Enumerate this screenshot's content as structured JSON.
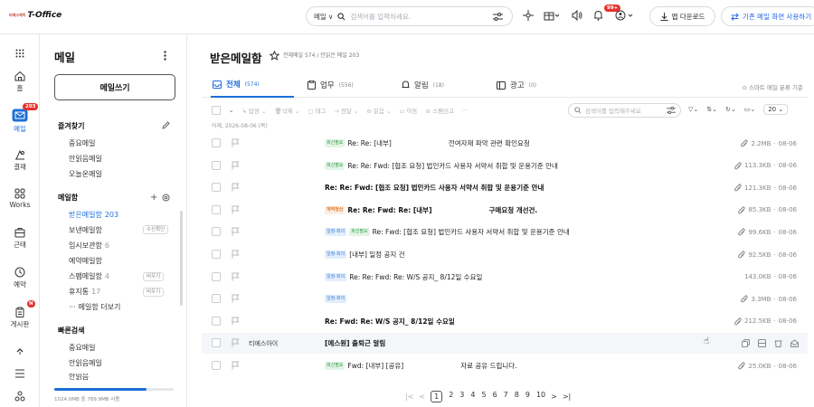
{
  "header": {
    "logo_small": "티에스에이",
    "logo_big": "T-Office",
    "search_scope": "메일",
    "search_placeholder": "검색어를 입력하세요.",
    "notification_badge": "99+",
    "app_download": "앱 다운로드",
    "old_mail_screen": "기존 메일 화면 사용하기"
  },
  "rail": [
    {
      "label": "홈",
      "icon": "home-icon"
    },
    {
      "label": "메일",
      "icon": "mail-icon",
      "badge": "203",
      "active": true
    },
    {
      "label": "결재",
      "icon": "approval-icon"
    },
    {
      "label": "Works",
      "icon": "works-icon"
    },
    {
      "label": "근태",
      "icon": "attendance-icon"
    },
    {
      "label": "예약",
      "icon": "reservation-icon"
    },
    {
      "label": "게시판",
      "icon": "board-icon",
      "badge": "N"
    }
  ],
  "mailnav": {
    "title": "메일",
    "compose": "메일쓰기",
    "favorites_title": "즐겨찾기",
    "favorites": [
      "중요메일",
      "안읽음메일",
      "오늘온메일"
    ],
    "mailbox_title": "메일함",
    "mailboxes": [
      {
        "label": "받은메일함",
        "count": "203",
        "active": true
      },
      {
        "label": "보낸메일함",
        "chip": "수신확인"
      },
      {
        "label": "임시보관함",
        "count": "6"
      },
      {
        "label": "예약메일함"
      },
      {
        "label": "스팸메일함",
        "count": "4",
        "chip": "비우기"
      },
      {
        "label": "휴지통",
        "count": "17",
        "chip": "비우기"
      },
      {
        "label": "메일함 더보기",
        "prefix": "···"
      }
    ],
    "quick_title": "빠른검색",
    "quick": [
      "중요메일",
      "안읽음메일",
      "안읽음"
    ],
    "quota": "1024.0MB 중 789.9MB 사용",
    "quota_fraction": 0.77
  },
  "main": {
    "title": "받은메일함",
    "subtitle": "전체메일 574 / 안읽은 메일 203",
    "tabs": [
      {
        "label": "전체",
        "count": "(574)",
        "icon": "inbox-icon",
        "active": true
      },
      {
        "label": "업무",
        "count": "(556)",
        "icon": "clipboard-icon"
      },
      {
        "label": "알림",
        "count": "(18)",
        "icon": "bell-icon"
      },
      {
        "label": "광고",
        "count": "(0)",
        "icon": "ad-icon"
      }
    ],
    "smart_sort": "스마트 메일 분류 기준",
    "toolbar": [
      "답장",
      "삭제",
      "태그",
      "전달",
      "읽음",
      "이동",
      "스팸신고",
      "···"
    ],
    "mail_search_placeholder": "검색어를 입력해주세요",
    "page_size": "20",
    "date_group": "어제, 2026-08-06 (목)",
    "mails": [
      {
        "tags": [
          {
            "t": "회신필요",
            "c": "green"
          }
        ],
        "subject": "Re: Re: [내부]",
        "extra": "전여자재 파악 관련 확인요청",
        "bold": false,
        "size": "2.2MB",
        "date": "08-06",
        "attach": true
      },
      {
        "tags": [
          {
            "t": "회신필요",
            "c": "green"
          }
        ],
        "subject": "Re: Re: Fwd: [협조 요청] 법인카드 사용자 서약서 취합 및 운용기준 안내",
        "bold": false,
        "size": "113.3KB",
        "date": "08-06",
        "attach": true
      },
      {
        "tags": [],
        "subject": "Re: Re: Fwd: [협조 요청] 법인카드 사용자 서약서 취합 및 운용기준 안내",
        "bold": true,
        "size": "121.3KB",
        "date": "08-06",
        "attach": true
      },
      {
        "tags": [
          {
            "t": "계약정산",
            "c": "orange"
          }
        ],
        "subject": "Re: Re: Fwd: Re: [내부]",
        "extra": "구매요청 개선건.",
        "bold": true,
        "size": "85.3KB",
        "date": "08-06",
        "attach": true
      },
      {
        "tags": [
          {
            "t": "일정-회의",
            "c": "blue"
          },
          {
            "t": "회신필요",
            "c": "green"
          }
        ],
        "subject": "Re: Fwd: [협조 요청] 법인카드 사용자 서약서 취합 및 운용기준 안내",
        "bold": false,
        "size": "99.6KB",
        "date": "08-06",
        "attach": true
      },
      {
        "tags": [
          {
            "t": "일정-회의",
            "c": "blue"
          }
        ],
        "subject": "[내부] 일정 공지 건",
        "bold": false,
        "size": "92.5KB",
        "date": "08-06",
        "attach": true
      },
      {
        "tags": [
          {
            "t": "일정-회의",
            "c": "blue"
          }
        ],
        "subject": "Re: Re: Fwd: Re: W/S 공지_ 8/12일 수요일",
        "bold": false,
        "size": "143.0KB",
        "date": "08-06",
        "attach": false
      },
      {
        "tags": [
          {
            "t": "일정-회의",
            "c": "blue"
          }
        ],
        "subject": "",
        "bold": false,
        "size": "3.3MB",
        "date": "08-06",
        "attach": true
      },
      {
        "tags": [],
        "subject": "Re: Fwd: Re: W/S 공지_ 8/12일 수요일",
        "bold": true,
        "size": "212.5KB",
        "date": "08-06",
        "attach": true
      },
      {
        "tags": [],
        "sender": "티에스아이",
        "subject": "[에스원] 출퇴근 알림",
        "bold": true,
        "size": "",
        "date": "",
        "attach": false,
        "hover": true
      },
      {
        "tags": [
          {
            "t": "회신필요",
            "c": "green"
          }
        ],
        "subject": "Fwd: [내부] [공유]",
        "extra": "자료 공유 드립니다.",
        "bold": false,
        "size": "25.0KB",
        "date": "08-06",
        "attach": true
      }
    ],
    "pages": [
      "1",
      "2",
      "3",
      "4",
      "5",
      "6",
      "7",
      "8",
      "9",
      "10"
    ]
  }
}
